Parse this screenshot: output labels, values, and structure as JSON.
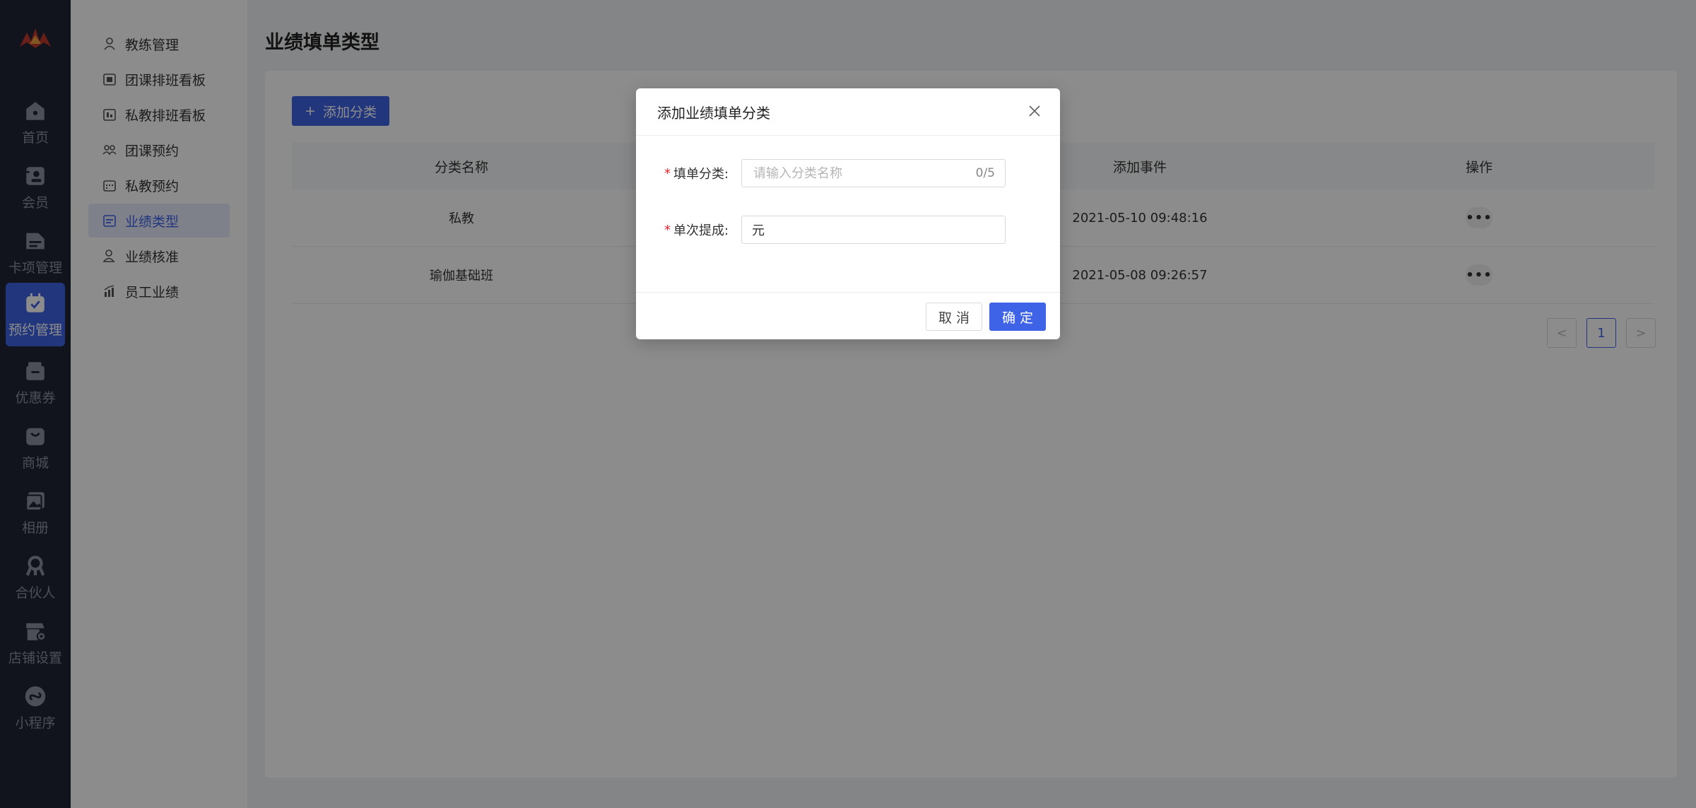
{
  "rail": {
    "items": [
      {
        "label": "首页",
        "icon": "home-icon"
      },
      {
        "label": "会员",
        "icon": "member-icon"
      },
      {
        "label": "卡项管理",
        "icon": "card-icon"
      },
      {
        "label": "预约管理",
        "icon": "calendar-check-icon",
        "active": true
      },
      {
        "label": "优惠券",
        "icon": "wallet-icon"
      },
      {
        "label": "商城",
        "icon": "shopping-bag-icon"
      },
      {
        "label": "相册",
        "icon": "album-icon"
      },
      {
        "label": "合伙人",
        "icon": "partner-icon"
      },
      {
        "label": "店铺设置",
        "icon": "store-settings-icon"
      },
      {
        "label": "小程序",
        "icon": "mini-program-icon"
      }
    ]
  },
  "subnav": {
    "items": [
      {
        "label": "教练管理",
        "icon": "user-icon"
      },
      {
        "label": "团课排班看板",
        "icon": "board-icon"
      },
      {
        "label": "私教排班看板",
        "icon": "board-icon"
      },
      {
        "label": "团课预约",
        "icon": "group-icon"
      },
      {
        "label": "私教预约",
        "icon": "calendar-icon"
      },
      {
        "label": "业绩类型",
        "icon": "list-icon",
        "active": true
      },
      {
        "label": "业绩核准",
        "icon": "user-check-icon"
      },
      {
        "label": "员工业绩",
        "icon": "chart-icon"
      }
    ]
  },
  "page": {
    "title": "业绩填单类型",
    "add_button": "添加分类"
  },
  "table": {
    "headers": [
      "分类名称",
      "",
      "添加事件",
      "操作"
    ],
    "rows": [
      {
        "name": "私教",
        "time": "2021-05-10 09:48:16",
        "action": "•••"
      },
      {
        "name": "瑜伽基础班",
        "time": "2021-05-08 09:26:57",
        "action": "•••"
      }
    ]
  },
  "pagination": {
    "prev": "<",
    "current": "1",
    "next": ">"
  },
  "modal": {
    "title": "添加业绩填单分类",
    "fields": {
      "category": {
        "label": "填单分类:",
        "placeholder": "请输入分类名称",
        "counter": "0/5"
      },
      "commission": {
        "label": "单次提成:",
        "value": "元"
      }
    },
    "cancel": "取 消",
    "confirm": "确 定"
  },
  "colors": {
    "primary": "#3f63e6",
    "rail_bg": "#202536",
    "required": "#f5222d"
  }
}
